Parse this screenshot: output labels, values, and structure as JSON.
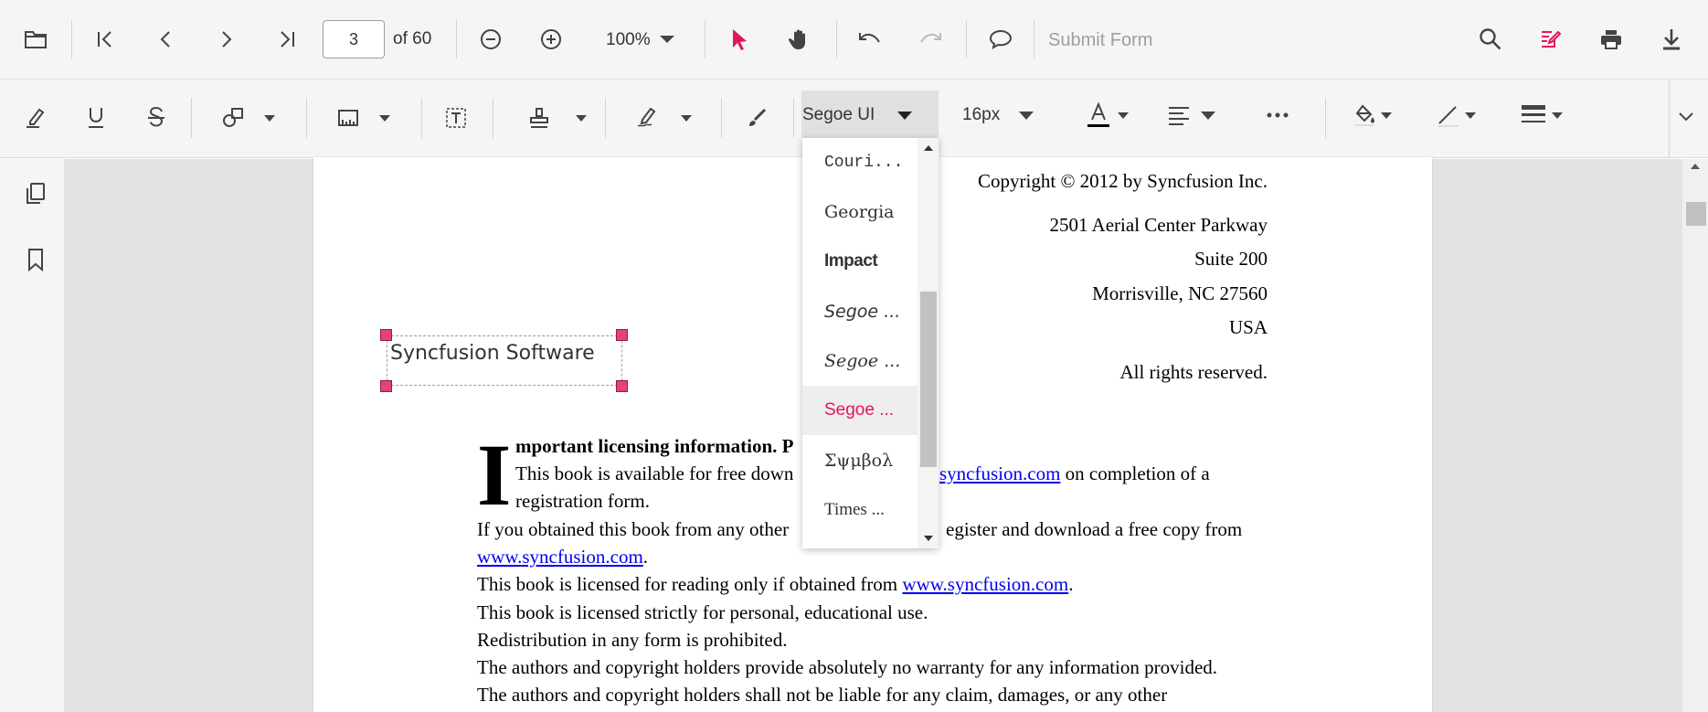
{
  "toolbar": {
    "page_number": "3",
    "page_of": "of 60",
    "zoom": "100%",
    "submit_form": "Submit Form"
  },
  "annotation_toolbar": {
    "font_family": "Segoe UI",
    "font_size": "16px"
  },
  "font_dropdown": {
    "items": [
      "Couri...",
      "Georgia",
      "Impact",
      "Segoe ...",
      "Segoe ...",
      "Segoe ...",
      "Σψμβολ",
      "Times ..."
    ],
    "selected_index": 5
  },
  "annotation": {
    "text": "Syncfusion Software"
  },
  "document": {
    "copyright": "Copyright © 2012 by Syncfusion Inc.",
    "address1": "2501 Aerial Center Parkway",
    "address2": "Suite 200",
    "address3": "Morrisville, NC 27560",
    "address4": "USA",
    "rights": "All rights reserved.",
    "dropcap": "I",
    "para1_bold": "mportant licensing information. P",
    "para1_line2_a": "This book is available for free down",
    "para1_line2_link": "syncfusion.com",
    "para1_line2_b": " on completion of a",
    "para1_line3": "registration form.",
    "para2_a": "If you obtained this book from any other",
    "para2_b": "egister and download a free copy from",
    "para2_link": "www.syncfusion.com",
    "para2_end": ".",
    "para3_a": "This book is licensed for reading only if obtained from ",
    "para3_link": "www.syncfusion.com",
    "para3_end": ".",
    "para4": "This book is licensed strictly for personal, educational use.",
    "para5": "Redistribution in any form is prohibited.",
    "para6": "The authors and copyright holders provide absolutely no warranty for any information provided.",
    "para7": "The authors and copyright holders shall not be liable for any claim, damages, or any other"
  },
  "colors": {
    "accent": "#e3165b",
    "link": "#0000ee"
  }
}
